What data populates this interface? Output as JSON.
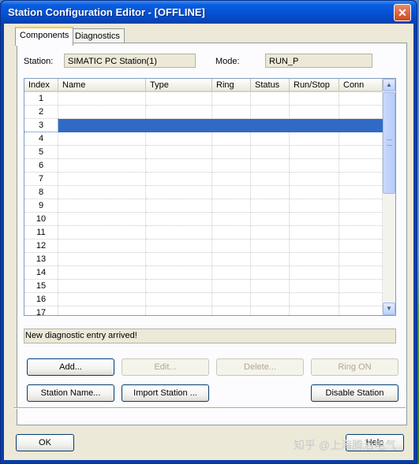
{
  "window": {
    "title": "Station Configuration Editor - [OFFLINE]"
  },
  "tabs": [
    {
      "label": "Components"
    },
    {
      "label": "Diagnostics"
    }
  ],
  "station": {
    "label": "Station:",
    "value": "SIMATIC PC Station(1)"
  },
  "mode": {
    "label": "Mode:",
    "value": "RUN_P"
  },
  "table": {
    "columns": [
      "Index",
      "Name",
      "Type",
      "Ring",
      "Status",
      "Run/Stop",
      "Conn"
    ],
    "rows": [
      "1",
      "2",
      "3",
      "4",
      "5",
      "6",
      "7",
      "8",
      "9",
      "10",
      "11",
      "12",
      "13",
      "14",
      "15",
      "16",
      "17"
    ],
    "selected_index": "3"
  },
  "status_message": "New diagnostic entry arrived!",
  "buttons": {
    "add": "Add...",
    "edit": "Edit...",
    "delete": "Delete...",
    "ring_on": "Ring ON",
    "station_name": "Station Name...",
    "import_station": "Import Station ...",
    "disable_station": "Disable Station",
    "ok": "OK",
    "help": "Help"
  },
  "watermark": "知乎 @上海腾治电气",
  "colors": {
    "titlebar": "#0553d6",
    "selection": "#316ac5",
    "dialog_bg": "#ece9d8"
  }
}
